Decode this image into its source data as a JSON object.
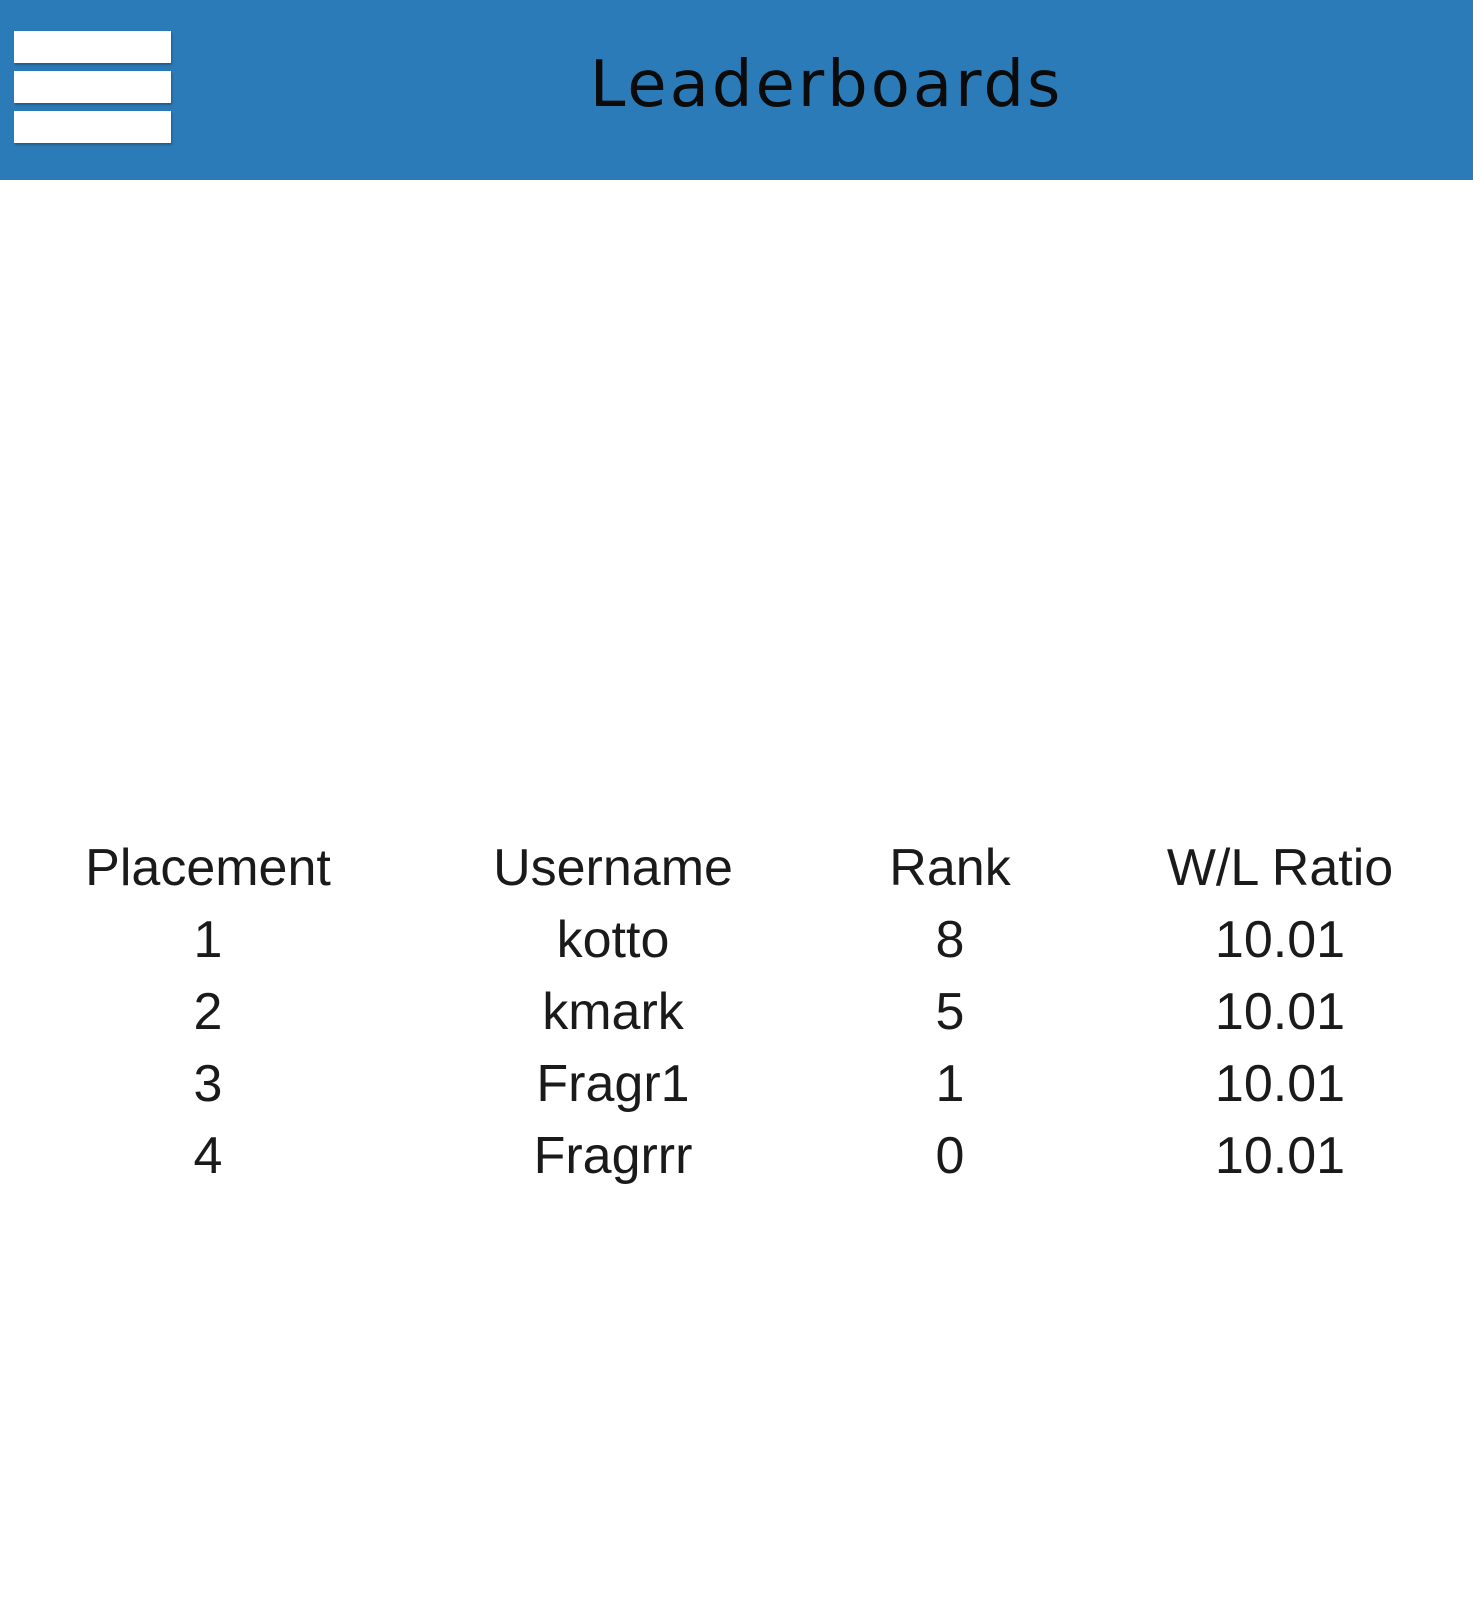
{
  "app_bar": {
    "title": "Leaderboards",
    "menu_icon": "hamburger-menu-icon",
    "color": "#2b7bb9"
  },
  "leaderboard": {
    "columns": [
      "Placement",
      "Username",
      "Rank",
      "W/L Ratio"
    ],
    "rows": [
      {
        "placement": "1",
        "username": "kotto",
        "rank": "8",
        "wl_ratio": "10.01"
      },
      {
        "placement": "2",
        "username": "kmark",
        "rank": "5",
        "wl_ratio": "10.01"
      },
      {
        "placement": "3",
        "username": "Fragr1",
        "rank": "1",
        "wl_ratio": "10.01"
      },
      {
        "placement": "4",
        "username": "Fragrrr",
        "rank": "0",
        "wl_ratio": "10.01"
      }
    ]
  }
}
